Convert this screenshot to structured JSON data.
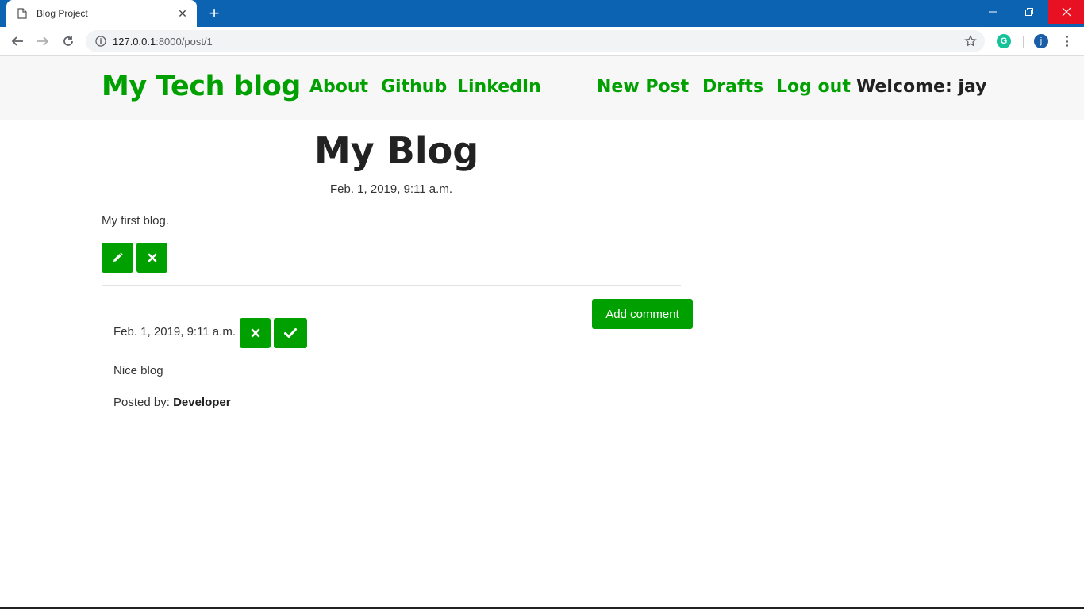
{
  "browser": {
    "tab_title": "Blog Project",
    "new_tab_label": "+",
    "url_host": "127.0.0.1",
    "url_path": ":8000/post/1",
    "profile_initial": "j",
    "grammarly_initial": "G"
  },
  "navbar": {
    "brand": "My Tech blog",
    "links": [
      "About",
      "Github",
      "LinkedIn",
      "New Post",
      "Drafts",
      "Log out"
    ],
    "welcome": "Welcome: jay"
  },
  "post": {
    "title": "My Blog",
    "date": "Feb. 1, 2019, 9:11 a.m.",
    "body": "My first blog."
  },
  "comments": {
    "add_label": "Add comment",
    "items": [
      {
        "date": "Feb. 1, 2019, 9:11 a.m.",
        "text": "Nice blog",
        "posted_by_label": "Posted by:",
        "author": "Developer"
      }
    ]
  },
  "colors": {
    "accent": "#00a000",
    "titlebar": "#0b63b2",
    "close_red": "#e81123"
  }
}
